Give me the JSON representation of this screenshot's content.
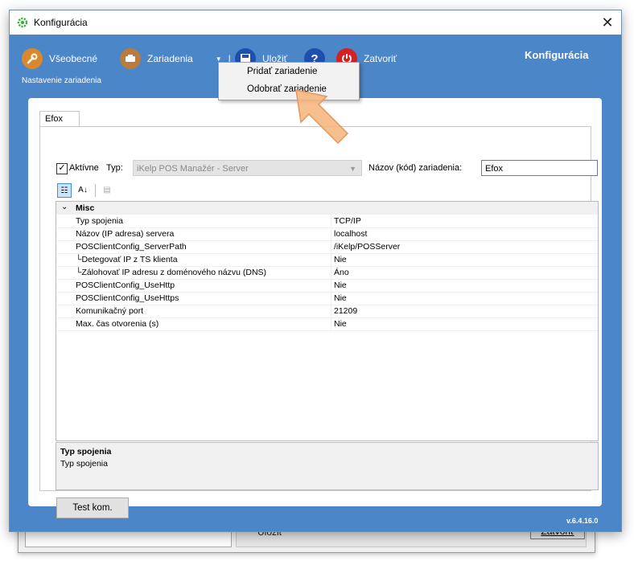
{
  "window": {
    "title": "Konfigurácia",
    "close_glyph": "✕",
    "brand": "Konfigurácia",
    "subtitle": "Nastavenie zariadenia",
    "version": "v.6.4.16.0"
  },
  "toolbar": {
    "general_label": "Všeobecné",
    "devices_label": "Zariadenia",
    "save_label": "Uložiť",
    "help_glyph": "?",
    "close_label": "Zatvoriť"
  },
  "devices_menu": {
    "items": [
      "Pridať zariadenie",
      "Odobrať zariadenie"
    ]
  },
  "tab": {
    "label": "Efox"
  },
  "form": {
    "active_label": "Aktívne",
    "active_checked": true,
    "type_label": "Typ:",
    "type_value": "iKelp POS Manažér - Server",
    "name_label": "Názov (kód) zariadenia:",
    "name_value": "Efox"
  },
  "property_grid": {
    "category": "Misc",
    "rows": [
      {
        "name": "Typ spojenia",
        "value": "TCP/IP"
      },
      {
        "name": "Názov (IP adresa) servera",
        "value": "localhost"
      },
      {
        "name": "POSClientConfig_ServerPath",
        "value": "/iKelp/POSServer"
      },
      {
        "name": "└Detegovať IP z TS klienta",
        "value": "Nie"
      },
      {
        "name": "└Zálohovať IP adresu z doménového názvu (DNS)",
        "value": "Áno"
      },
      {
        "name": "POSClientConfig_UseHttp",
        "value": "Nie"
      },
      {
        "name": "POSClientConfig_UseHttps",
        "value": "Nie"
      },
      {
        "name": "Komunikačný port",
        "value": "21209"
      },
      {
        "name": "Max. čas otvorenia (s)",
        "value": "Nie"
      }
    ],
    "description_title": "Typ spojenia",
    "description_text": "Typ spojenia"
  },
  "buttons": {
    "test": "Test kom."
  },
  "background_window": {
    "save_label": "Uložiť",
    "close_label": "Zatvoriť"
  },
  "colors": {
    "window_blue": "#4a86c8",
    "general_icon": "#d9892b",
    "devices_icon": "#b97c3e",
    "save_icon": "#1e4fb0",
    "help_icon": "#1e4fb0",
    "close_icon": "#d32222",
    "pointer_arrow": "#f6b47a"
  }
}
